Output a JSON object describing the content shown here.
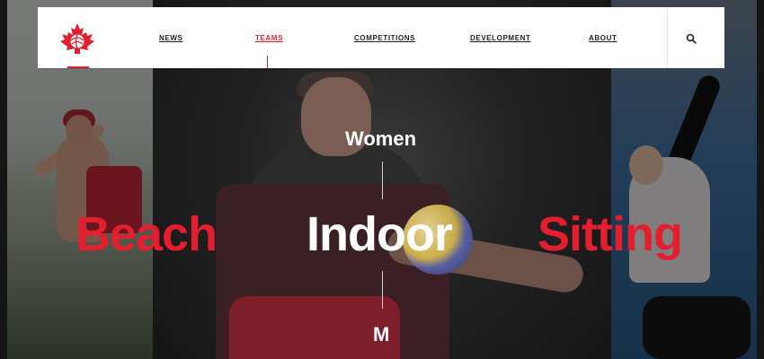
{
  "nav": {
    "items": [
      {
        "label": "NEWS"
      },
      {
        "label": "TEAMS"
      },
      {
        "label": "COMPETITIONS"
      },
      {
        "label": "DEVELOPMENT"
      },
      {
        "label": "ABOUT"
      }
    ],
    "active_index": 1,
    "search_icon": "search-icon",
    "logo_icon": "maple-leaf-volleyball-logo"
  },
  "main": {
    "gender_top": "Women",
    "disciplines": [
      {
        "label": "Beach",
        "color": "#e21f2f"
      },
      {
        "label": "Indoor",
        "color": "#ffffff"
      },
      {
        "label": "Sitting",
        "color": "#e21f2f"
      }
    ],
    "gender_bottom": "M"
  },
  "colors": {
    "accent": "#e21f2f",
    "nav_bg": "#ffffff",
    "page_bg": "#151515"
  }
}
